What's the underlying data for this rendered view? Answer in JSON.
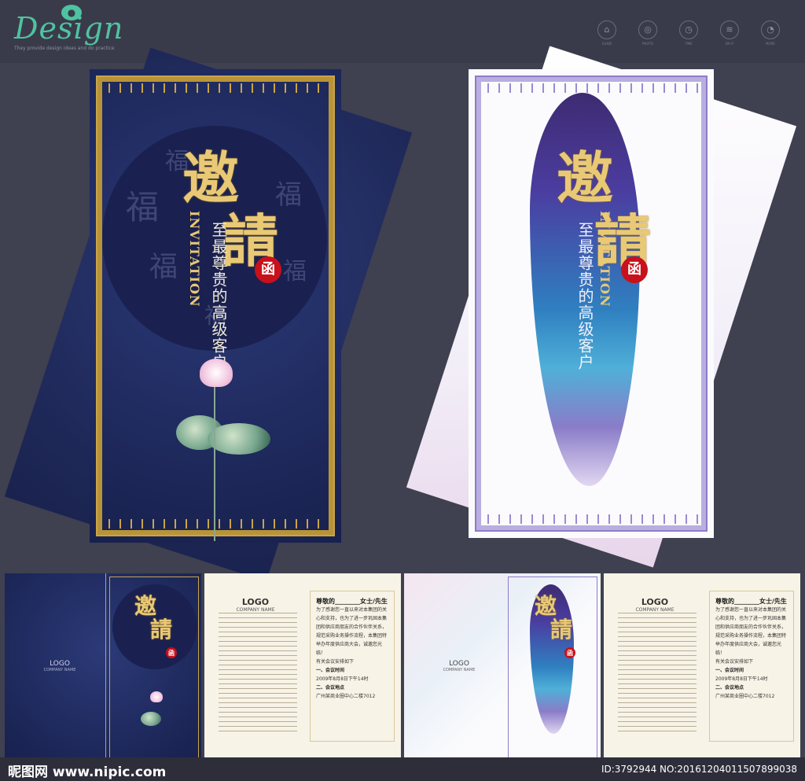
{
  "header": {
    "logo_text": "Design",
    "logo_sub": "They provide design ideas and do practice",
    "tools": [
      {
        "icon": "hat-icon",
        "glyph": "⌂",
        "caption": "GUIDE"
      },
      {
        "icon": "camera-icon",
        "glyph": "◎",
        "caption": "PHOTO"
      },
      {
        "icon": "clock-icon",
        "glyph": "◷",
        "caption": "TIME"
      },
      {
        "icon": "wifi-icon",
        "glyph": "≋",
        "caption": "WI-FI"
      },
      {
        "icon": "pie-icon",
        "glyph": "◔",
        "caption": "MORE"
      }
    ]
  },
  "card": {
    "title_char_1": "邀",
    "title_char_2": "請",
    "invitation": "INVITATION",
    "subtitle": "至最尊贵的高级客户",
    "seal_char": "函",
    "fu_char": "福"
  },
  "bottom": {
    "logo": "LOGO",
    "company": "COMPANY NAME",
    "greeting": "尊敬的",
    "honorific": "女士/先生",
    "body": "为了感谢您一直以来对本集团的关心和支持，也为了进一步巩固本集团和供应商朋友的合作伙伴关系，规范采购业务操作流程，本集团特举办年度供应商大会，诚邀您光临！",
    "meeting_notice": "有关会议安排如下",
    "item1_label": "一、会议时间",
    "item1_value": "2009年8月8日下午14时",
    "item2_label": "二、会议地点",
    "item2_value": "广州某商业圈中心二楼7012"
  },
  "watermark": {
    "site": "昵图网 www.nipic.com",
    "id": "ID:3792944 NO:20161204011507899038"
  },
  "colors": {
    "gold": "#c9a44a",
    "navy": "#1f2a5e",
    "violet": "#8e7bc7",
    "seal_red": "#c8111b",
    "logo_green": "#4fc3a1"
  }
}
